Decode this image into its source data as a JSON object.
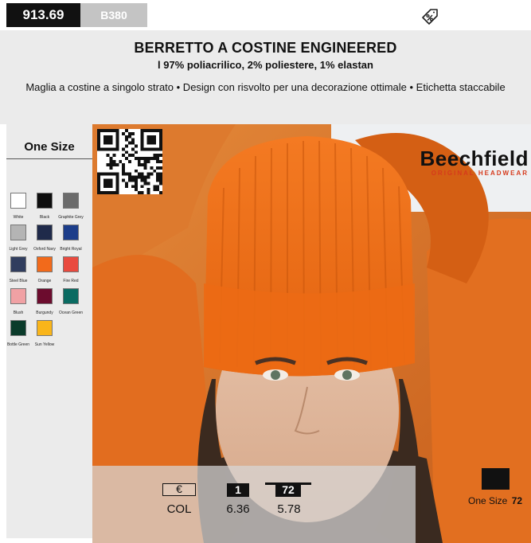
{
  "header": {
    "price": "913.69",
    "product_code": "B380"
  },
  "product": {
    "title": "BERRETTO A COSTINE ENGINEERED",
    "composition": "l 97% poliacrilico, 2% poliestere, 1% elastan",
    "features": "Maglia a costine a singolo strato • Design con risvolto per una decorazione ottimale • Etichetta staccabile"
  },
  "sizes": {
    "label": "One Size"
  },
  "colors": [
    {
      "name": "White",
      "hex": "#ffffff"
    },
    {
      "name": "Black",
      "hex": "#0e0e0e"
    },
    {
      "name": "Graphite Grey",
      "hex": "#6b6b6b"
    },
    {
      "name": "Light Grey",
      "hex": "#b4b4b4"
    },
    {
      "name": "Oxford Navy",
      "hex": "#1f2a4a"
    },
    {
      "name": "Bright Royal",
      "hex": "#1c3d8a"
    },
    {
      "name": "Steel Blue",
      "hex": "#303d5e"
    },
    {
      "name": "Orange",
      "hex": "#f26a1b"
    },
    {
      "name": "Fire Red",
      "hex": "#e94a3f"
    },
    {
      "name": "Blush",
      "hex": "#f0a1a4"
    },
    {
      "name": "Burgundy",
      "hex": "#6c0c2e"
    },
    {
      "name": "Ocean Green",
      "hex": "#0a6b62"
    },
    {
      "name": "Bottle Green",
      "hex": "#0b3b2a"
    },
    {
      "name": "Sun Yellow",
      "hex": "#f9b51a"
    }
  ],
  "brand": {
    "name": "Beechfield",
    "tagline": "ORIGINAL HEADWEAR"
  },
  "pricing": {
    "currency_symbol": "€",
    "qty_1_label": "1",
    "qty_72_label": "72",
    "col_label": "COL",
    "price_qty_1": "6.36",
    "price_qty_72": "5.78"
  },
  "carton": {
    "size_label": "One Size",
    "quantity": "72"
  },
  "icons": {
    "discount": "percent-tag-icon",
    "qr": "qr-code-icon",
    "carton": "carton-box-icon"
  },
  "accent_colors": {
    "brand_red": "#d63a1c",
    "background_gray": "#ebebeb"
  }
}
